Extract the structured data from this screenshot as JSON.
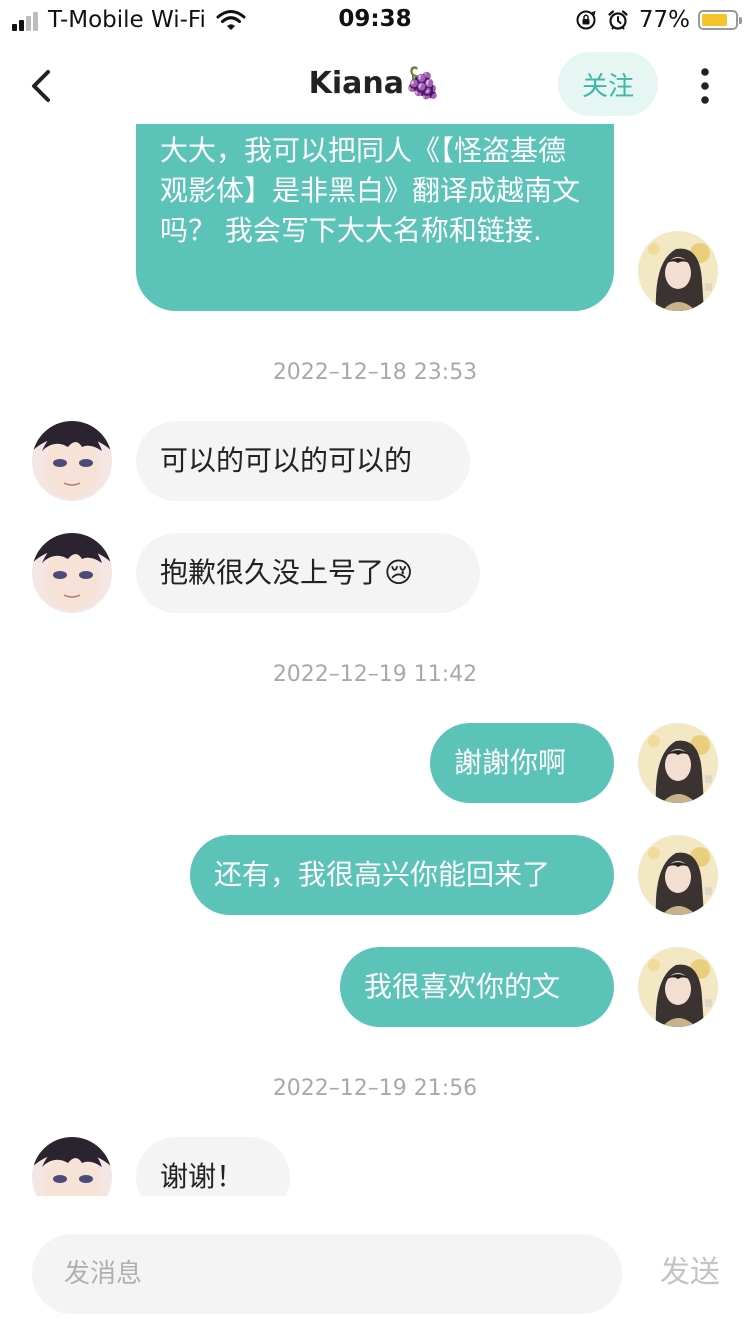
{
  "status_bar": {
    "carrier": "T-Mobile Wi-Fi",
    "time": "09:38",
    "battery_percent": "77%",
    "battery_level": 0.77,
    "battery_color": "#f5c32c"
  },
  "nav": {
    "title": "Kiana🍇",
    "follow_label": "关注"
  },
  "chat": {
    "messages": [
      {
        "side": "out",
        "text": "大大，我可以把同人《【怪盗基德观影体】是非黑白》翻译成越南文吗？ 我会写下大大名称和链接."
      },
      {
        "timestamp": "2022–12–18 23:53"
      },
      {
        "side": "in",
        "text": "可以的可以的可以的"
      },
      {
        "side": "in",
        "text": "抱歉很久没上号了😢"
      },
      {
        "timestamp": "2022–12–19 11:42"
      },
      {
        "side": "out",
        "text": "謝謝你啊"
      },
      {
        "side": "out",
        "text": "还有，我很高兴你能回来了"
      },
      {
        "side": "out",
        "text": "我很喜欢你的文"
      },
      {
        "timestamp": "2022–12–19 21:56"
      },
      {
        "side": "in",
        "text": "谢谢！"
      }
    ]
  },
  "input": {
    "placeholder": "发消息",
    "value": "",
    "send_label": "发送"
  },
  "colors": {
    "outgoing_bubble": "#5cc3b9",
    "incoming_bubble": "#f4f4f4",
    "accent": "#41b7a8"
  },
  "icons": [
    "signal-icon",
    "wifi-icon",
    "rotation-lock-icon",
    "alarm-icon",
    "battery-icon",
    "back-chevron-icon",
    "more-vertical-icon"
  ]
}
